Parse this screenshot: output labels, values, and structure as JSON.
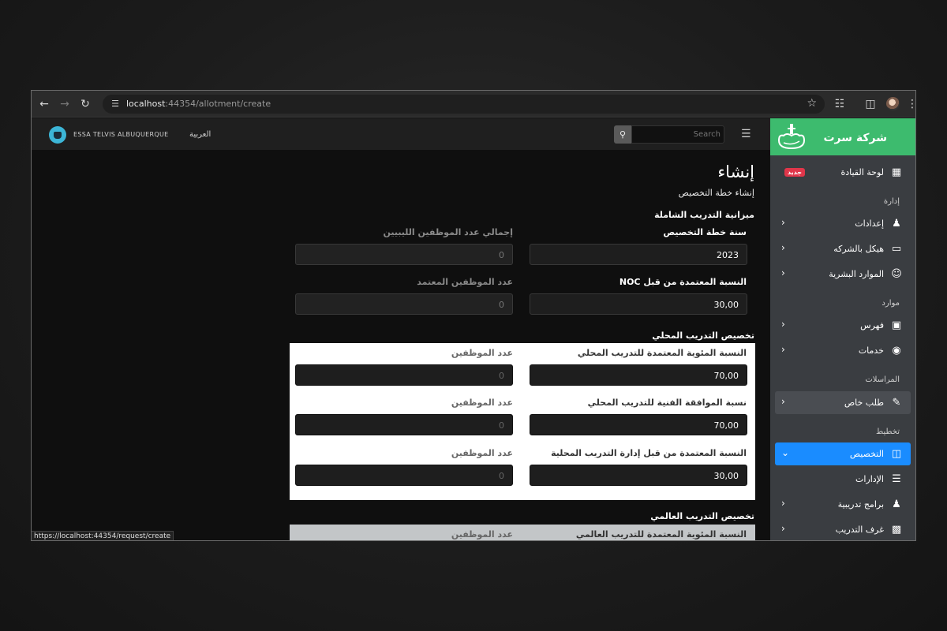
{
  "browser": {
    "url_host": "localhost",
    "url_path": ":44354/allotment/create",
    "status_url": "https://localhost:44354/request/create"
  },
  "header": {
    "user_name": "ESSA TELVIS ALBUQUERQUE",
    "language": "العربية",
    "search_placeholder": "Search"
  },
  "main": {
    "title": "إنشاء",
    "subtitle": "إنشاء خطة التخصيص",
    "overall_section": "ميزانية التدريب الشاملة",
    "overall_fields": {
      "plan_year_label": "سنة خطة التخصيص",
      "plan_year_value": "2023",
      "total_libyan_label": "إجمالي عدد الموظفين الليبيين",
      "total_libyan_value": "0",
      "noc_ratio_label": "النسبة المعتمدة من قبل NOC",
      "noc_ratio_value": "30,00",
      "approved_employees_label": "عدد الموظفين المعتمد",
      "approved_employees_value": "0"
    },
    "local_section": "تخصيص التدريب المحلي",
    "local_fields": [
      {
        "label": "النسبة المئوية المعتمدة للتدريب المحلي",
        "value": "70,00",
        "count_label": "عدد الموظفين",
        "count_value": "0"
      },
      {
        "label": "نسبة الموافقة الفنية للتدريب المحلي",
        "value": "70,00",
        "count_label": "عدد الموظفين",
        "count_value": "0"
      },
      {
        "label": "النسبة المعتمدة من قبل إدارة التدريب المحلية",
        "value": "30,00",
        "count_label": "عدد الموظفين",
        "count_value": "0"
      }
    ],
    "global_section": "تخصيص التدريب العالمي",
    "global_fields": {
      "label": "النسبة المئوية المعتمدة للتدريب العالمي",
      "count_label": "عدد الموظفين"
    }
  },
  "sidebar": {
    "brand": "شركة سرت",
    "dashboard": "لوحة القيادة",
    "new_badge": "جديد",
    "sections": {
      "admin": "إدارة",
      "resources": "موارد",
      "correspondence": "المراسلات",
      "planning": "تخطيط"
    },
    "items": {
      "settings": "إعدادات",
      "structure": "هيكل بالشركه",
      "hr": "الموارد البشرية",
      "index": "فهرس",
      "services": "خدمات",
      "special_request": "طلب خاص",
      "allotment": "التخصيص",
      "departments": "الإدارات",
      "programs": "برامج تدريبية",
      "rooms": "غرف التدريب"
    }
  },
  "colors": {
    "brand_green": "#3dbb6e",
    "active_blue": "#1a8cff",
    "badge_red": "#e0364a"
  }
}
